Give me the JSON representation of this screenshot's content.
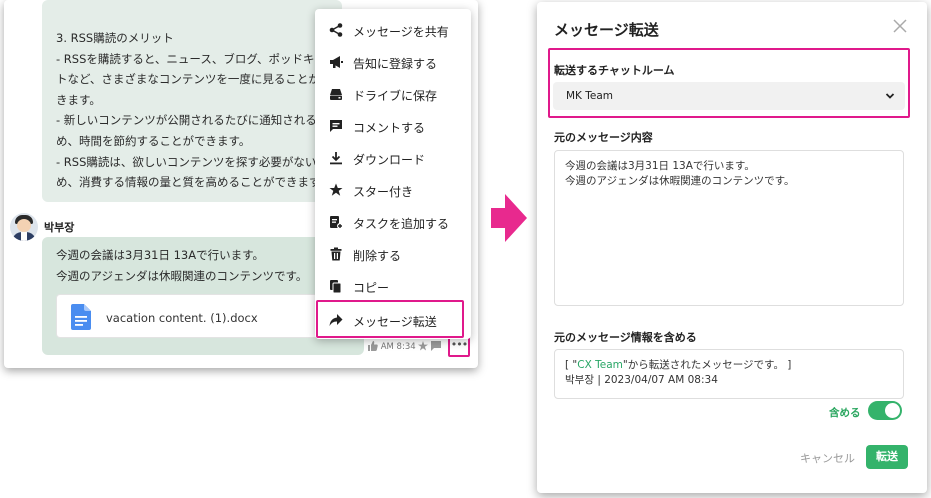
{
  "chat": {
    "rss_bubble": {
      "lines": [
        "3. RSS購読のメリット",
        "- RSSを購読すると、ニュース、ブログ、ポッドキ",
        "トなど、さまざまなコンテンツを一度に見ることが",
        "きます。",
        "- 新しいコンテンツが公開されるたびに通知されるた",
        "め、時間を節約することができます。",
        "- RSS購読は、欲しいコンテンツを探す必要がない",
        "め、消費する情報の量と質を高めることができます"
      ]
    },
    "sender": "박부장",
    "message": {
      "lines": [
        "今週の会議は3月31日 13Aで行います。",
        "今週のアジェンダは休暇関連のコンテンツです。"
      ],
      "file_name": "vacation content. (1).docx",
      "time": "AM 8:34",
      "more": "•••"
    },
    "menu": {
      "items": [
        {
          "label": "メッセージを共有",
          "icon": "share-icon"
        },
        {
          "label": "告知に登録する",
          "icon": "megaphone-icon"
        },
        {
          "label": "ドライブに保存",
          "icon": "drive-icon"
        },
        {
          "label": "コメントする",
          "icon": "comment-icon"
        },
        {
          "label": "ダウンロード",
          "icon": "download-icon"
        },
        {
          "label": "スター付き",
          "icon": "star-icon"
        },
        {
          "label": "タスクを追加する",
          "icon": "task-add-icon"
        },
        {
          "label": "削除する",
          "icon": "trash-icon"
        },
        {
          "label": "コピー",
          "icon": "copy-icon"
        },
        {
          "label": "メッセージ転送",
          "icon": "forward-icon"
        }
      ]
    }
  },
  "dialog": {
    "title": "メッセージ転送",
    "chatroom_label": "転送するチャットルーム",
    "chatroom_value": "MK Team",
    "original_label": "元のメッセージ内容",
    "original_lines": [
      "今週の会議は3月31日 13Aで行います。",
      "今週のアジェンダは休暇関連のコンテンツです。"
    ],
    "info_label": "元のメッセージ情報を含める",
    "info_prefix": "[ \"",
    "info_team": "CX Team",
    "info_suffix": "\"から転送されたメッセージです。 ]",
    "info_sender_line": "박부장 | 2023/04/07 AM 08:34",
    "include_label": "含める",
    "include_on": true,
    "cancel_label": "キャンセル",
    "send_label": "転送"
  },
  "colors": {
    "accent_highlight": "#e0198b",
    "brand_green": "#34b36b",
    "bubble_green": "#d7e6dd"
  }
}
